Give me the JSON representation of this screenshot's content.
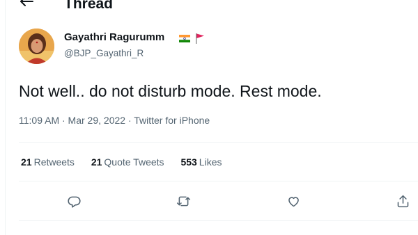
{
  "header": {
    "title": "Thread"
  },
  "tweet": {
    "author_name": "Gayathri Ragurumm",
    "author_handle": "@BJP_Gayathri_R",
    "text": "Not well.. do not disturb mode. Rest mode.",
    "timestamp": "11:09 AM · Mar 29, 2022 · Twitter for iPhone"
  },
  "stats": {
    "retweets_count": "21",
    "retweets_label": "Retweets",
    "quotes_count": "21",
    "quotes_label": "Quote Tweets",
    "likes_count": "553",
    "likes_label": "Likes"
  },
  "icons": [
    "back-arrow-icon",
    "india-flag-icon",
    "red-flag-icon",
    "reply-icon",
    "retweet-icon",
    "like-icon",
    "share-icon"
  ],
  "colors": {
    "secondary_text": "#536471",
    "divider": "#eff3f4",
    "text": "#0f1419"
  }
}
